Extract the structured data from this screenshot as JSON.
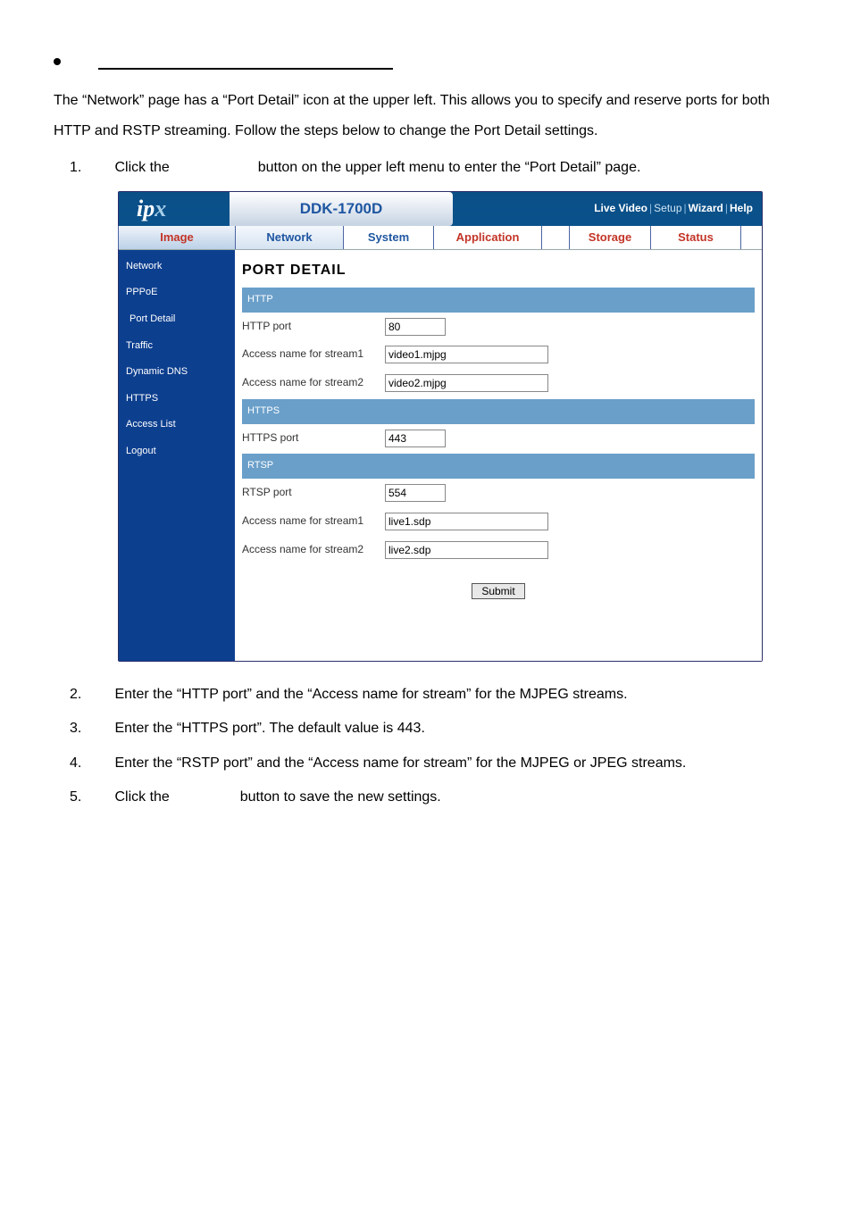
{
  "bullet_heading_visible_text": "",
  "intro": "The “Network” page has a “Port Detail” icon at the upper left. This allows you to specify and reserve ports for both HTTP and RSTP streaming. Follow the steps below to change the Port Detail settings.",
  "steps": [
    {
      "num": "1.",
      "before": "Click the ",
      "gap": "",
      "after": " button on the upper left menu to enter the “Port Detail” page."
    },
    {
      "num": "2.",
      "text": "Enter the “HTTP port” and the “Access name for stream” for the MJPEG streams."
    },
    {
      "num": "3.",
      "text": "Enter the “HTTPS port”. The default value is 443."
    },
    {
      "num": "4.",
      "text": "Enter the “RSTP port” and the “Access name for stream” for the MJPEG or JPEG streams."
    },
    {
      "num": "5.",
      "before": "Click the ",
      "gap": "",
      "after": " button to save the new settings."
    }
  ],
  "screenshot": {
    "logo": "ipx",
    "model": "DDK-1700D",
    "toplinks": {
      "live": "Live Video",
      "setup": "Setup",
      "wizard": "Wizard",
      "help": "Help"
    },
    "tabs": {
      "image": "Image",
      "network": "Network",
      "system": "System",
      "application": "Application",
      "storage": "Storage",
      "status": "Status"
    },
    "sidebar": [
      "Network",
      "PPPoE",
      "Port Detail",
      "Traffic",
      "Dynamic DNS",
      "HTTPS",
      "Access List",
      "Logout"
    ],
    "title": "PORT DETAIL",
    "sections": {
      "http": {
        "header": "HTTP",
        "rows": [
          {
            "label": "HTTP port",
            "value": "80",
            "cls": "port"
          },
          {
            "label": "Access name for stream1",
            "value": "video1.mjpg",
            "cls": "name"
          },
          {
            "label": "Access name for stream2",
            "value": "video2.mjpg",
            "cls": "name"
          }
        ]
      },
      "https": {
        "header": "HTTPS",
        "rows": [
          {
            "label": "HTTPS port",
            "value": "443",
            "cls": "port"
          }
        ]
      },
      "rtsp": {
        "header": "RTSP",
        "rows": [
          {
            "label": "RTSP port",
            "value": "554",
            "cls": "port"
          },
          {
            "label": "Access name for stream1",
            "value": "live1.sdp",
            "cls": "name"
          },
          {
            "label": "Access name for stream2",
            "value": "live2.sdp",
            "cls": "name"
          }
        ]
      }
    },
    "submit": "Submit"
  }
}
